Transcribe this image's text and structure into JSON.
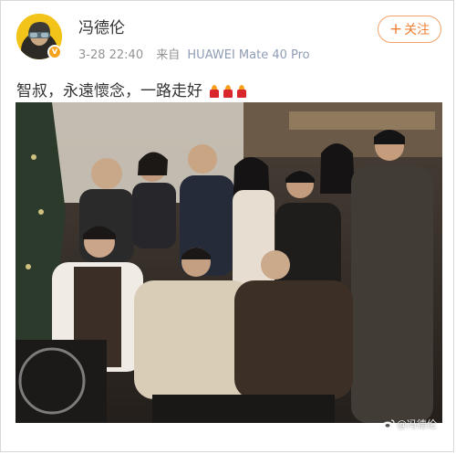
{
  "post": {
    "author": "冯德伦",
    "timestamp": "3-28 22:40",
    "source_label": "来自",
    "device": "HUAWEI Mate 40 Pro",
    "follow_label": "关注",
    "follow_plus": "+",
    "verified_badge": "v",
    "text": "智叔，永遠懷念，一路走好",
    "text_emoji": [
      "candle-emoji",
      "candle-emoji",
      "candle-emoji"
    ],
    "watermark": "@冯德伦"
  },
  "colors": {
    "accent_orange": "#f08034",
    "badge": "#f6a21c",
    "meta_gray": "#939393",
    "text_dark": "#333333"
  }
}
